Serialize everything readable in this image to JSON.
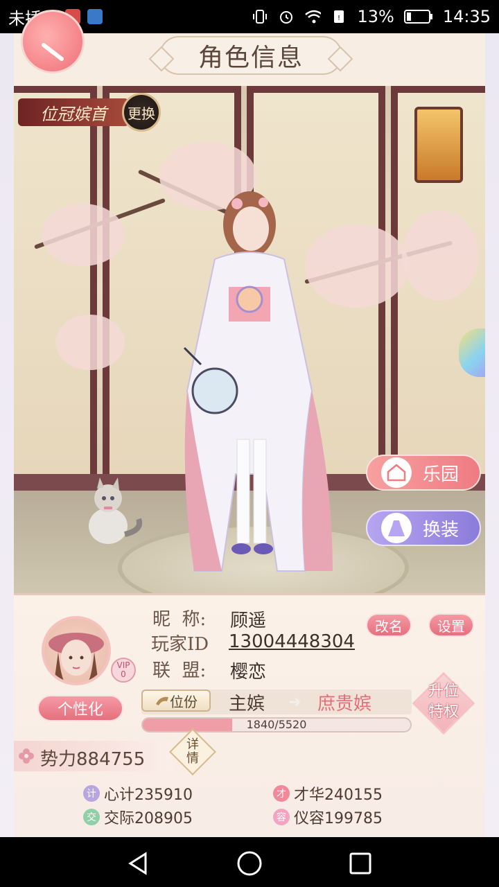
{
  "status_bar": {
    "carrier": "未插卡",
    "battery": "13%",
    "time": "14:35"
  },
  "header": {
    "title": "角色信息"
  },
  "scene": {
    "rank_title": "位冠嫔首",
    "change_label": "更换",
    "park_label": "乐园",
    "dress_label": "换装"
  },
  "profile": {
    "nickname_label": "昵  称:",
    "nickname": "顾遥",
    "player_id_label": "玩家ID",
    "player_id": "13004448304",
    "alliance_label": "联  盟:",
    "alliance": "樱恋",
    "rename_label": "改名",
    "settings_label": "设置",
    "vip_label": "VIP",
    "vip_level": "0",
    "personalize_label": "个性化"
  },
  "rank": {
    "chip_label": "位份",
    "current": "主嫔",
    "next": "庶贵嫔",
    "progress_text": "1840/5520",
    "progress_fraction": 0.333,
    "upgrade_line1": "升位",
    "upgrade_line2": "特权"
  },
  "power": {
    "text": "势力884755",
    "detail_line1": "详",
    "detail_line2": "情"
  },
  "stats": [
    {
      "badge": "计",
      "text": "心计235910",
      "color": "#b7a6e0"
    },
    {
      "badge": "才",
      "text": "才华240155",
      "color": "#f08a9a"
    },
    {
      "badge": "交",
      "text": "交际208905",
      "color": "#8fd0a6"
    },
    {
      "badge": "容",
      "text": "仪容199785",
      "color": "#f1a5c0"
    }
  ],
  "colors": {
    "accent_pink": "#e66f7d",
    "frame_bg": "#fbf3ea"
  }
}
